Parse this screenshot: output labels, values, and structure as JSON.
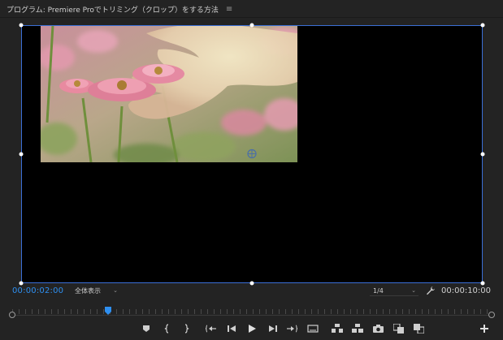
{
  "panel": {
    "title": "プログラム: Premiere Proでトリミング（クロップ）をする方法",
    "menu_glyph": "≡"
  },
  "viewer": {
    "background": "#000000",
    "outline_color": "#3b6fd6"
  },
  "controls": {
    "current_timecode": "00:00:02:00",
    "fit_label": "全体表示",
    "resolution_label": "1/4",
    "duration_timecode": "00:00:10:00"
  },
  "timeline": {
    "playhead_fraction": 0.2
  },
  "transport": {
    "buttons": [
      "marker-icon",
      "mark-in-icon",
      "mark-out-icon",
      "go-to-in-icon",
      "step-back-icon",
      "play-icon",
      "step-forward-icon",
      "go-to-out-icon",
      "safe-margins-icon",
      "lift-icon",
      "extract-icon",
      "export-frame-icon",
      "comparison-view-icon",
      "proxy-toggle-icon",
      "add-button-icon"
    ]
  },
  "colors": {
    "accent": "#2e8ff0",
    "panel_bg": "#232323"
  }
}
